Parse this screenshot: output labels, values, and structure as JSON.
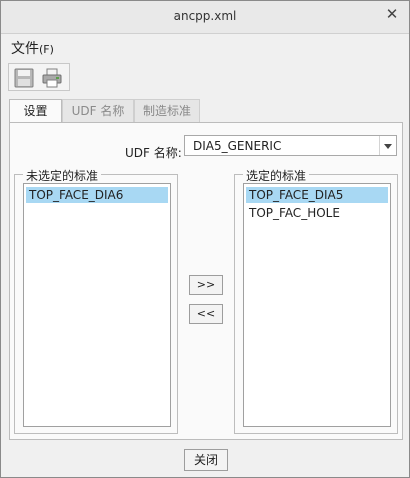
{
  "window": {
    "title": "ancpp.xml",
    "close_icon": "close-icon"
  },
  "menu": {
    "file_label": "文件",
    "file_accel": "(F)"
  },
  "toolbar": {
    "save_icon": "save-icon",
    "print_icon": "print-icon"
  },
  "tabs": [
    {
      "label": "设置",
      "active": true
    },
    {
      "label": "UDF 名称",
      "active": false
    },
    {
      "label": "制造标准",
      "active": false
    }
  ],
  "udf": {
    "label": "UDF 名称:",
    "selected": "DIA5_GENERIC"
  },
  "unselected_group": {
    "legend": "未选定的标准",
    "items": [
      "TOP_FACE_DIA6"
    ],
    "selected_index": 0
  },
  "selected_group": {
    "legend": "选定的标准",
    "items": [
      "TOP_FACE_DIA5",
      "TOP_FAC_HOLE"
    ],
    "selected_index": 0
  },
  "buttons": {
    "add": ">>",
    "remove": "<<",
    "close": "关闭"
  },
  "colors": {
    "selection": "#a8d8f3",
    "background": "#f0f0f0"
  }
}
